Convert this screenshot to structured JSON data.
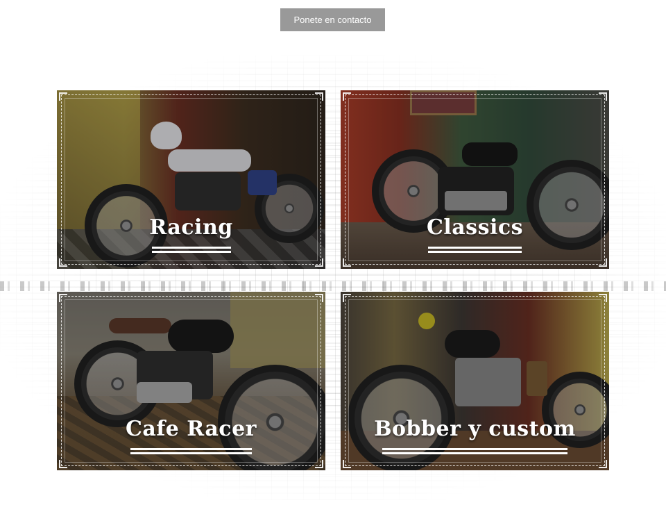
{
  "header": {
    "contact_button": "Ponete en contacto"
  },
  "categories": [
    {
      "title": "Racing"
    },
    {
      "title": "Classics"
    },
    {
      "title": "Cafe Racer"
    },
    {
      "title": "Bobber y custom"
    }
  ],
  "colors": {
    "button_bg": "#999999",
    "button_text": "#ffffff",
    "title_text": "#ffffff"
  }
}
